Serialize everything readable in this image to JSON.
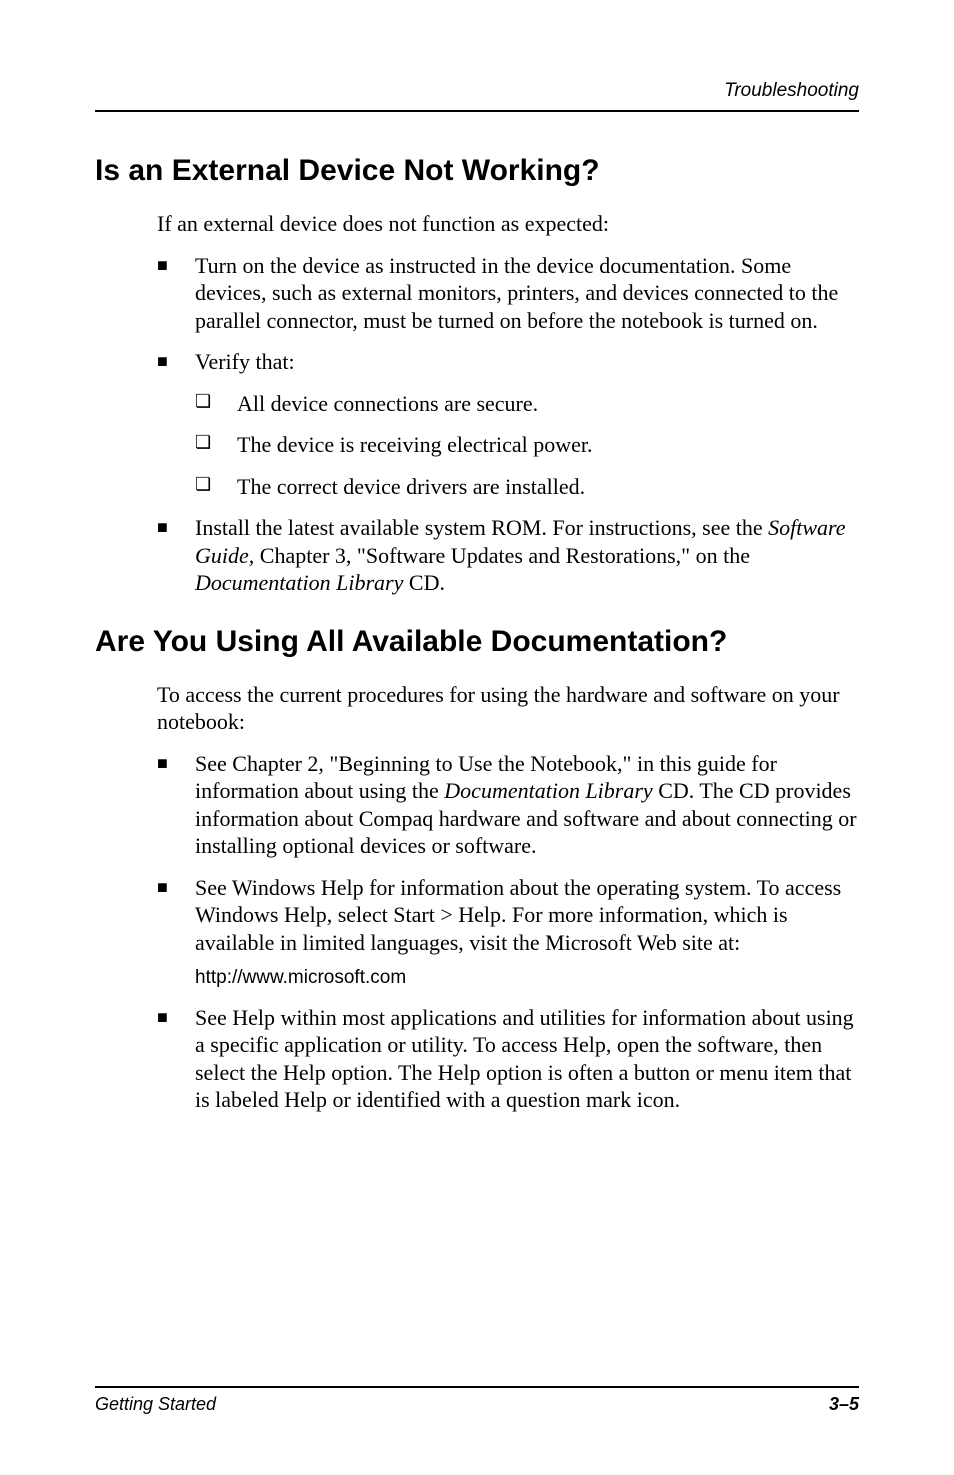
{
  "header": {
    "running_title": "Troubleshooting"
  },
  "section1": {
    "heading": "Is an External Device Not Working?",
    "intro": "If an external device does not function as expected:",
    "bullets": [
      {
        "text": "Turn on the device as instructed in the device documentation. Some devices, such as external monitors, printers, and devices connected to the parallel connector, must be turned on before the notebook is turned on."
      },
      {
        "text": "Verify that:",
        "sub": [
          "All device connections are secure.",
          "The device is receiving electrical power.",
          "The correct device drivers are installed."
        ]
      },
      {
        "prefix": "Install the latest available system ROM. For instructions, see the ",
        "italic1": "Software Guide,",
        "mid": " Chapter 3, \"Software Updates and Restorations,\" on the ",
        "italic2": "Documentation Library",
        "suffix": " CD."
      }
    ]
  },
  "section2": {
    "heading": "Are You Using All Available Documentation?",
    "intro": "To access the current procedures for using the hardware and software on your notebook:",
    "bullets": [
      {
        "prefix": "See Chapter 2, \"Beginning to Use the Notebook,\" in this guide for information about using the ",
        "italic1": "Documentation Library",
        "suffix": " CD. The CD provides information about Compaq hardware and software and about connecting or installing optional devices or software."
      },
      {
        "text": "See Windows Help for information about the operating system. To access Windows Help, select Start > Help. For more information, which is available in limited languages, visit the Microsoft Web site at:",
        "url": "http://www.microsoft.com"
      },
      {
        "text": "See Help within most applications and utilities for information about using a specific application or utility. To access Help, open the software, then select the Help option. The Help option is often a button or menu item that is labeled Help or identified with a question mark icon."
      }
    ]
  },
  "footer": {
    "left": "Getting Started",
    "right": "3–5"
  }
}
